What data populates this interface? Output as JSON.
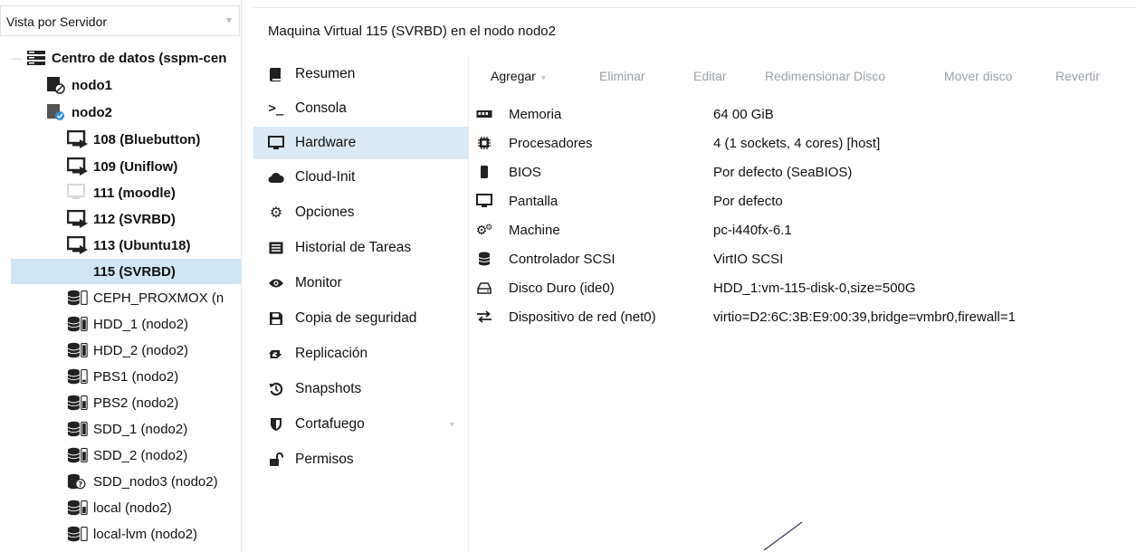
{
  "tree": {
    "view_selector": "Vista por Servidor",
    "items": [
      {
        "label": "Centro de datos (sspm-cen",
        "icon": "datacenter-icon"
      },
      {
        "label": "nodo1",
        "icon": "node-offline-icon"
      },
      {
        "label": "nodo2",
        "icon": "node-online-icon"
      },
      {
        "label": "108 (Bluebutton)",
        "icon": "vm-running-icon"
      },
      {
        "label": "109 (Uniflow)",
        "icon": "vm-running-icon"
      },
      {
        "label": "111 (moodle)",
        "icon": "vm-stopped-icon"
      },
      {
        "label": "112 (SVRBD)",
        "icon": "vm-running-icon"
      },
      {
        "label": "113 (Ubuntu18)",
        "icon": "vm-running-icon"
      },
      {
        "label": "115 (SVRBD)",
        "icon": "vm-selected-icon"
      },
      {
        "label": "CEPH_PROXMOX (n",
        "icon": "storage-icon"
      },
      {
        "label": "HDD_1 (nodo2)",
        "icon": "storage-icon"
      },
      {
        "label": "HDD_2 (nodo2)",
        "icon": "storage-icon"
      },
      {
        "label": "PBS1 (nodo2)",
        "icon": "storage-icon"
      },
      {
        "label": "PBS2 (nodo2)",
        "icon": "storage-icon"
      },
      {
        "label": "SDD_1 (nodo2)",
        "icon": "storage-icon"
      },
      {
        "label": "SDD_2 (nodo2)",
        "icon": "storage-icon"
      },
      {
        "label": "SDD_nodo3 (nodo2)",
        "icon": "storage-unknown-icon"
      },
      {
        "label": "local (nodo2)",
        "icon": "storage-icon"
      },
      {
        "label": "local-lvm (nodo2)",
        "icon": "storage-icon"
      }
    ]
  },
  "header": {
    "title": "Maquina Virtual 115 (SVRBD) en el nodo nodo2"
  },
  "nav": {
    "items": [
      {
        "label": "Resumen",
        "icon": "book-icon"
      },
      {
        "label": "Consola",
        "icon": "terminal-icon"
      },
      {
        "label": "Hardware",
        "icon": "monitor-icon"
      },
      {
        "label": "Cloud-Init",
        "icon": "cloud-icon"
      },
      {
        "label": "Opciones",
        "icon": "gear-icon"
      },
      {
        "label": "Historial de Tareas",
        "icon": "list-icon"
      },
      {
        "label": "Monitor",
        "icon": "eye-icon"
      },
      {
        "label": "Copia de seguridad",
        "icon": "floppy-icon"
      },
      {
        "label": "Replicación",
        "icon": "retweet-icon"
      },
      {
        "label": "Snapshots",
        "icon": "history-icon"
      },
      {
        "label": "Cortafuego",
        "icon": "shield-icon"
      },
      {
        "label": "Permisos",
        "icon": "unlock-icon"
      }
    ]
  },
  "toolbar": {
    "add": "Agregar",
    "remove": "Eliminar",
    "edit": "Editar",
    "resize": "Redimensionar Disco",
    "move": "Mover disco",
    "revert": "Revertir"
  },
  "hardware": [
    {
      "name": "Memoria",
      "value": "64 00 GiB",
      "icon": "memory-icon"
    },
    {
      "name": "Procesadores",
      "value": "4 (1 sockets, 4 cores) [host]",
      "icon": "cpu-icon"
    },
    {
      "name": "BIOS",
      "value": "Por defecto (SeaBIOS)",
      "icon": "microchip-icon"
    },
    {
      "name": "Pantalla",
      "value": "Por defecto",
      "icon": "desktop-icon"
    },
    {
      "name": "Machine",
      "value": "pc-i440fx-6.1",
      "icon": "cogs-icon"
    },
    {
      "name": "Controlador SCSI",
      "value": "VirtIO SCSI",
      "icon": "database-icon"
    },
    {
      "name": "Disco Duro (ide0)",
      "value": "HDD_1:vm-115-disk-0,size=500G",
      "icon": "hdd-icon"
    },
    {
      "name": "Dispositivo de red (net0)",
      "value": "virtio=D2:6C:3B:E9:00:39,bridge=vmbr0,firewall=1",
      "icon": "exchange-icon"
    }
  ]
}
